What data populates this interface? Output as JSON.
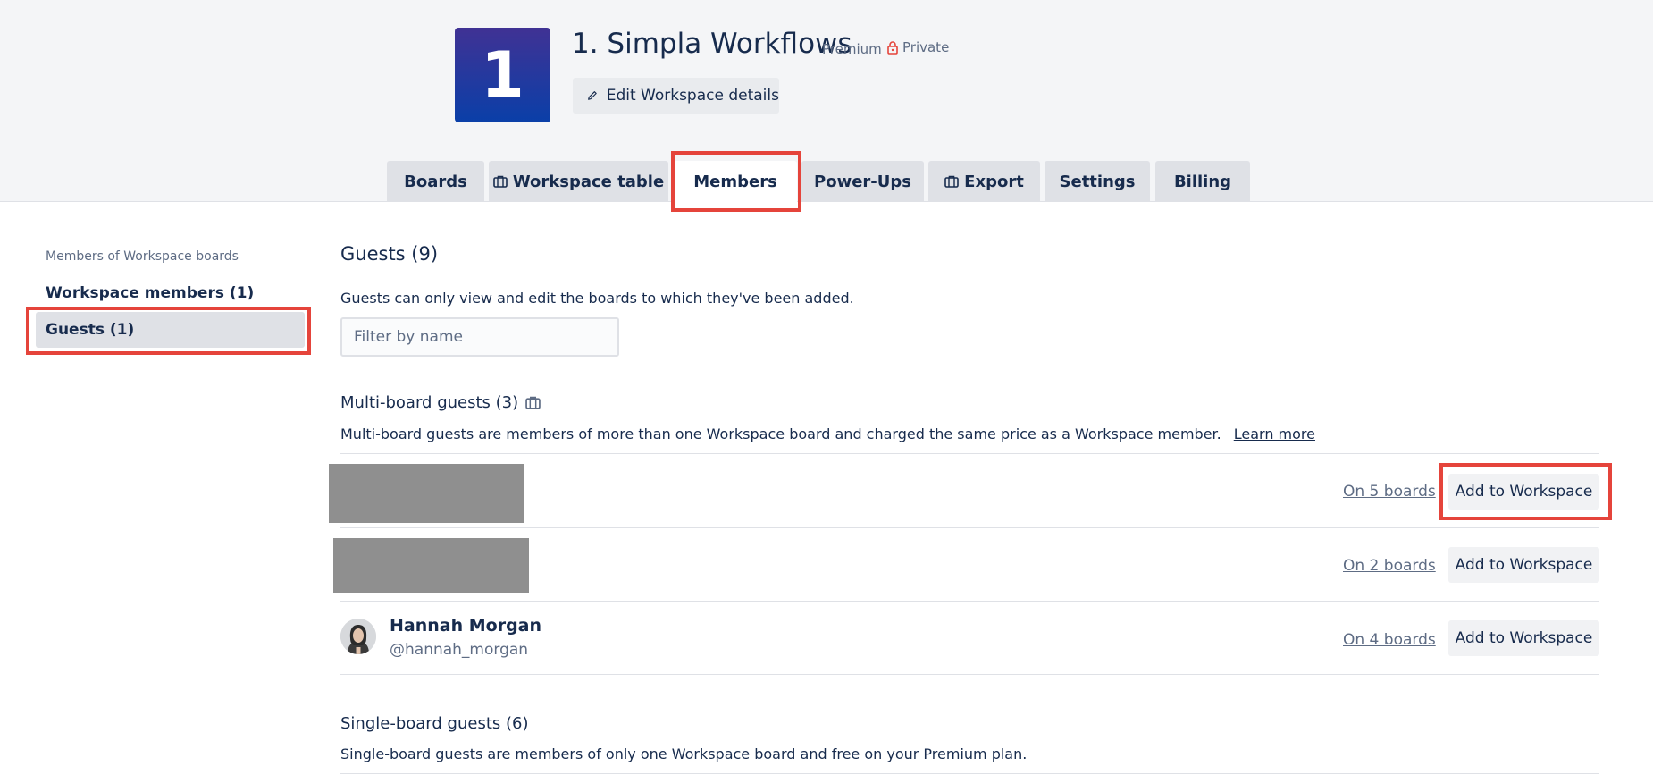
{
  "workspace": {
    "logo_text": "1",
    "title": "1. Simpla Workflows",
    "plan_badge": "Premium",
    "visibility": "Private",
    "edit_label": "Edit Workspace details"
  },
  "tabs": [
    {
      "label": "Boards",
      "icon": null,
      "active": false
    },
    {
      "label": "Workspace table",
      "icon": "briefcase-icon",
      "active": false
    },
    {
      "label": "Members",
      "icon": null,
      "active": true
    },
    {
      "label": "Power-Ups",
      "icon": null,
      "active": false
    },
    {
      "label": "Export",
      "icon": "briefcase-icon",
      "active": false
    },
    {
      "label": "Settings",
      "icon": null,
      "active": false
    },
    {
      "label": "Billing",
      "icon": null,
      "active": false
    }
  ],
  "sidebar": {
    "heading": "Members of Workspace boards",
    "items": [
      {
        "label": "Workspace members (1)",
        "active": false
      },
      {
        "label": "Guests (1)",
        "active": true
      }
    ]
  },
  "guests": {
    "title": "Guests (9)",
    "description": "Guests can only view and edit the boards to which they've been added.",
    "filter_placeholder": "Filter by name"
  },
  "multi_board": {
    "title": "Multi-board guests (3)",
    "description": "Multi-board guests are members of more than one Workspace board and charged the same price as a Workspace member.",
    "learn_more": "Learn more",
    "rows": [
      {
        "name": "",
        "handle": "",
        "redacted": true,
        "boards": "On 5 boards",
        "action": "Add to Workspace"
      },
      {
        "name": "",
        "handle": "",
        "redacted": true,
        "boards": "On 2 boards",
        "action": "Add to Workspace"
      },
      {
        "name": "Hannah Morgan",
        "handle": "@hannah_morgan",
        "redacted": false,
        "boards": "On 4 boards",
        "action": "Add to Workspace"
      }
    ]
  },
  "single_board": {
    "title": "Single-board guests (6)",
    "description": "Single-board guests are members of only one Workspace board and free on your Premium plan."
  },
  "colors": {
    "highlight": "#e5443b",
    "logo_gradient_top": "#403294",
    "logo_gradient_bottom": "#0a3fa8",
    "text": "#172b4d",
    "subtle_text": "#5e6c84"
  }
}
